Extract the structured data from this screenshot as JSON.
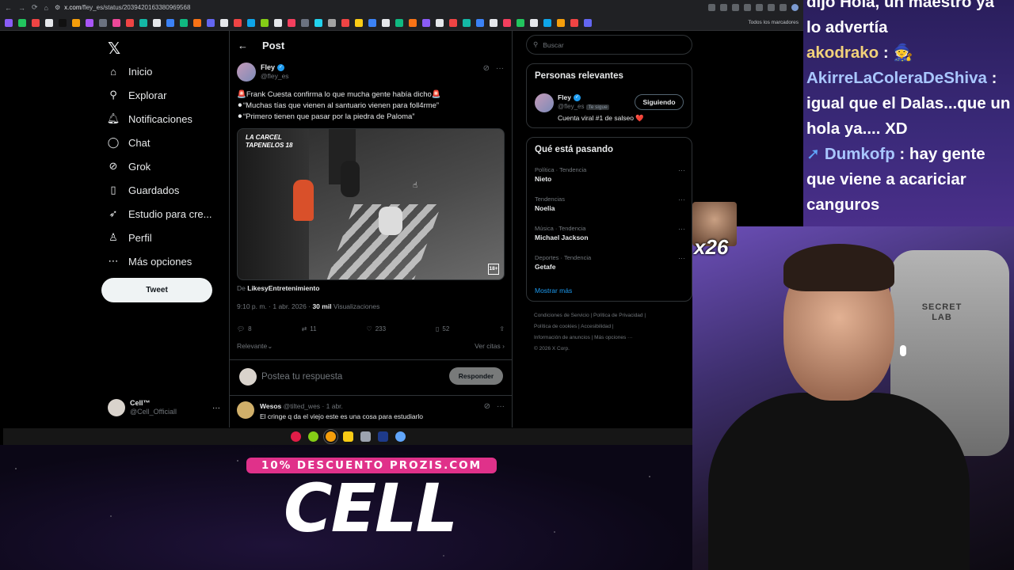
{
  "browser": {
    "url_host": "x.com",
    "url_path": "/fley_es/status/2039420163380969568",
    "bookmarks_folder": "Todos los marcadores"
  },
  "nav": {
    "items": [
      {
        "label": "Inicio",
        "icon": "home-icon"
      },
      {
        "label": "Explorar",
        "icon": "search-icon"
      },
      {
        "label": "Notificaciones",
        "icon": "bell-icon"
      },
      {
        "label": "Chat",
        "icon": "chat-icon"
      },
      {
        "label": "Grok",
        "icon": "grok-icon"
      },
      {
        "label": "Guardados",
        "icon": "bookmark-icon"
      },
      {
        "label": "Estudio para cre...",
        "icon": "rocket-icon"
      },
      {
        "label": "Perfil",
        "icon": "person-icon"
      },
      {
        "label": "Más opciones",
        "icon": "more-circle-icon"
      }
    ],
    "tweet_button": "Tweet",
    "profile": {
      "name": "Cell™",
      "handle": "@Cell_Officiall"
    }
  },
  "post": {
    "header": "Post",
    "author_name": "Fley",
    "author_handle": "@fley_es",
    "lines": [
      "🚨Frank Cuesta confirma lo que mucha gente había dicho🚨",
      "⚫“Muchas tías que vienen al santuario vienen para foll4rme”",
      "⚫“Primero tienen que pasar por la piedra de Paloma”"
    ],
    "media_logo": "LA CARCEL TAPENELOS 18",
    "media_rating": "18+",
    "from_prefix": "De",
    "from_source": "LikesyEntretenimiento",
    "time": "9:10 p. m. · 1 abr. 2026 · ",
    "views_count": "30 mil",
    "views_label": " Visualizaciones",
    "stats": {
      "replies": "8",
      "reposts": "11",
      "likes": "233",
      "bookmarks": "52"
    },
    "sort_label": "Relevante",
    "quotes_label": "Ver citas",
    "reply_placeholder": "Postea tu respuesta",
    "reply_button": "Responder"
  },
  "reply": {
    "name": "Wesos",
    "handle": "@tilted_wes",
    "date": "· 1 abr.",
    "text": "El cringe q da el viejo este es una cosa para estudiarlo"
  },
  "sidebar": {
    "search_placeholder": "Buscar",
    "relevant_title": "Personas relevantes",
    "relevant": {
      "name": "Fley",
      "handle": "@fley_es",
      "tag": "Te sigue",
      "bio": "Cuenta viral #1 de salseo ❤️",
      "follow_label": "Siguiendo"
    },
    "trends_title": "Qué está pasando",
    "trends": [
      {
        "cat": "Política · Tendencia",
        "topic": "Nieto"
      },
      {
        "cat": "Tendencias",
        "topic": "Noelia"
      },
      {
        "cat": "Música · Tendencia",
        "topic": "Michael Jackson"
      },
      {
        "cat": "Deportes · Tendencia",
        "topic": "Getafe"
      }
    ],
    "show_more": "Mostrar más",
    "footer_line1": "Condiciones de Servicio  |  Política de Privacidad  |",
    "footer_line2": "Política de cookies  |  Accesibilidad  |",
    "footer_line3": "Información de anuncios  |  Más opciones ···",
    "footer_line4": "© 2026 X Corp."
  },
  "stream": {
    "promo": "10% DESCUENTO PROZIS.COM",
    "logo": "CELL",
    "emote_count": "x26",
    "chair_brand": "SECRET LAB",
    "chat": [
      {
        "user": "",
        "text": "dijo Hola, un maestro ya lo advertía",
        "user_color": "white"
      },
      {
        "user": "akodrako",
        "text": " : 🧙",
        "user_color": "gold"
      },
      {
        "user": "AkirreLaColeraDeShiva",
        "text": " : igual que el Dalas...que un hola ya.... XD",
        "user_color": "blue"
      },
      {
        "user": "Dumkofp",
        "text": " : hay gente que viene a acariciar canguros",
        "user_color": "blue"
      }
    ]
  },
  "colors": {
    "accent": "#1d9bf0",
    "promo": "#e0318a",
    "background": "#000000"
  }
}
